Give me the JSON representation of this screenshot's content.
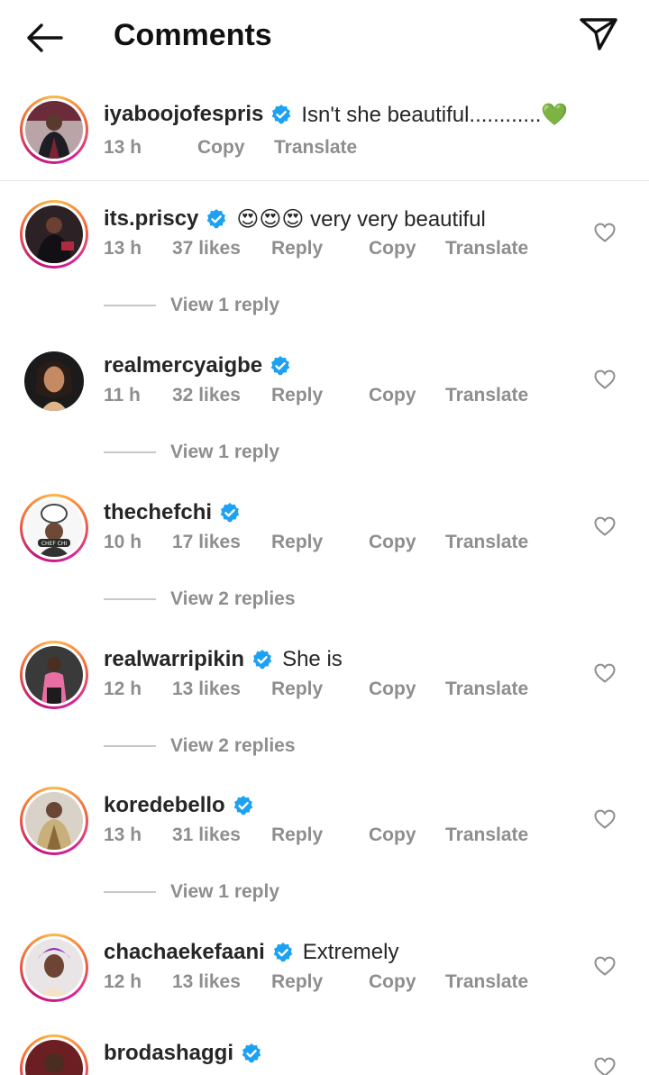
{
  "header": {
    "title": "Comments",
    "back_icon": "arrow-left-icon",
    "send_icon": "paper-plane-icon"
  },
  "caption": {
    "username": "iyaboojofespris",
    "text": "Isn't she beautiful............💚",
    "time": "13 h",
    "copy": "Copy",
    "translate": "Translate"
  },
  "comments": [
    {
      "username": "its.priscy",
      "text": "😍😍😍 very very beautiful",
      "time": "13 h",
      "likes": "37 likes",
      "reply": "Reply",
      "copy": "Copy",
      "translate": "Translate",
      "view_replies": "View 1 reply"
    },
    {
      "username": "realmercyaigbe",
      "text": "",
      "time": "11 h",
      "likes": "32 likes",
      "reply": "Reply",
      "copy": "Copy",
      "translate": "Translate",
      "view_replies": "View 1 reply"
    },
    {
      "username": "thechefchi",
      "text": "",
      "time": "10 h",
      "likes": "17 likes",
      "reply": "Reply",
      "copy": "Copy",
      "translate": "Translate",
      "view_replies": "View 2 replies"
    },
    {
      "username": "realwarripikin",
      "text": "She is",
      "time": "12 h",
      "likes": "13 likes",
      "reply": "Reply",
      "copy": "Copy",
      "translate": "Translate",
      "view_replies": "View 2 replies"
    },
    {
      "username": "koredebello",
      "text": "",
      "time": "13 h",
      "likes": "31 likes",
      "reply": "Reply",
      "copy": "Copy",
      "translate": "Translate",
      "view_replies": "View 1 reply"
    },
    {
      "username": "chachaekefaani",
      "text": "Extremely",
      "time": "12 h",
      "likes": "13 likes",
      "reply": "Reply",
      "copy": "Copy",
      "translate": "Translate"
    },
    {
      "username": "brodashaggi",
      "text": ""
    }
  ],
  "colors": {
    "verified": "#1da1f2",
    "meta_text": "#8e8e8e",
    "divider": "#e3e3e3"
  }
}
